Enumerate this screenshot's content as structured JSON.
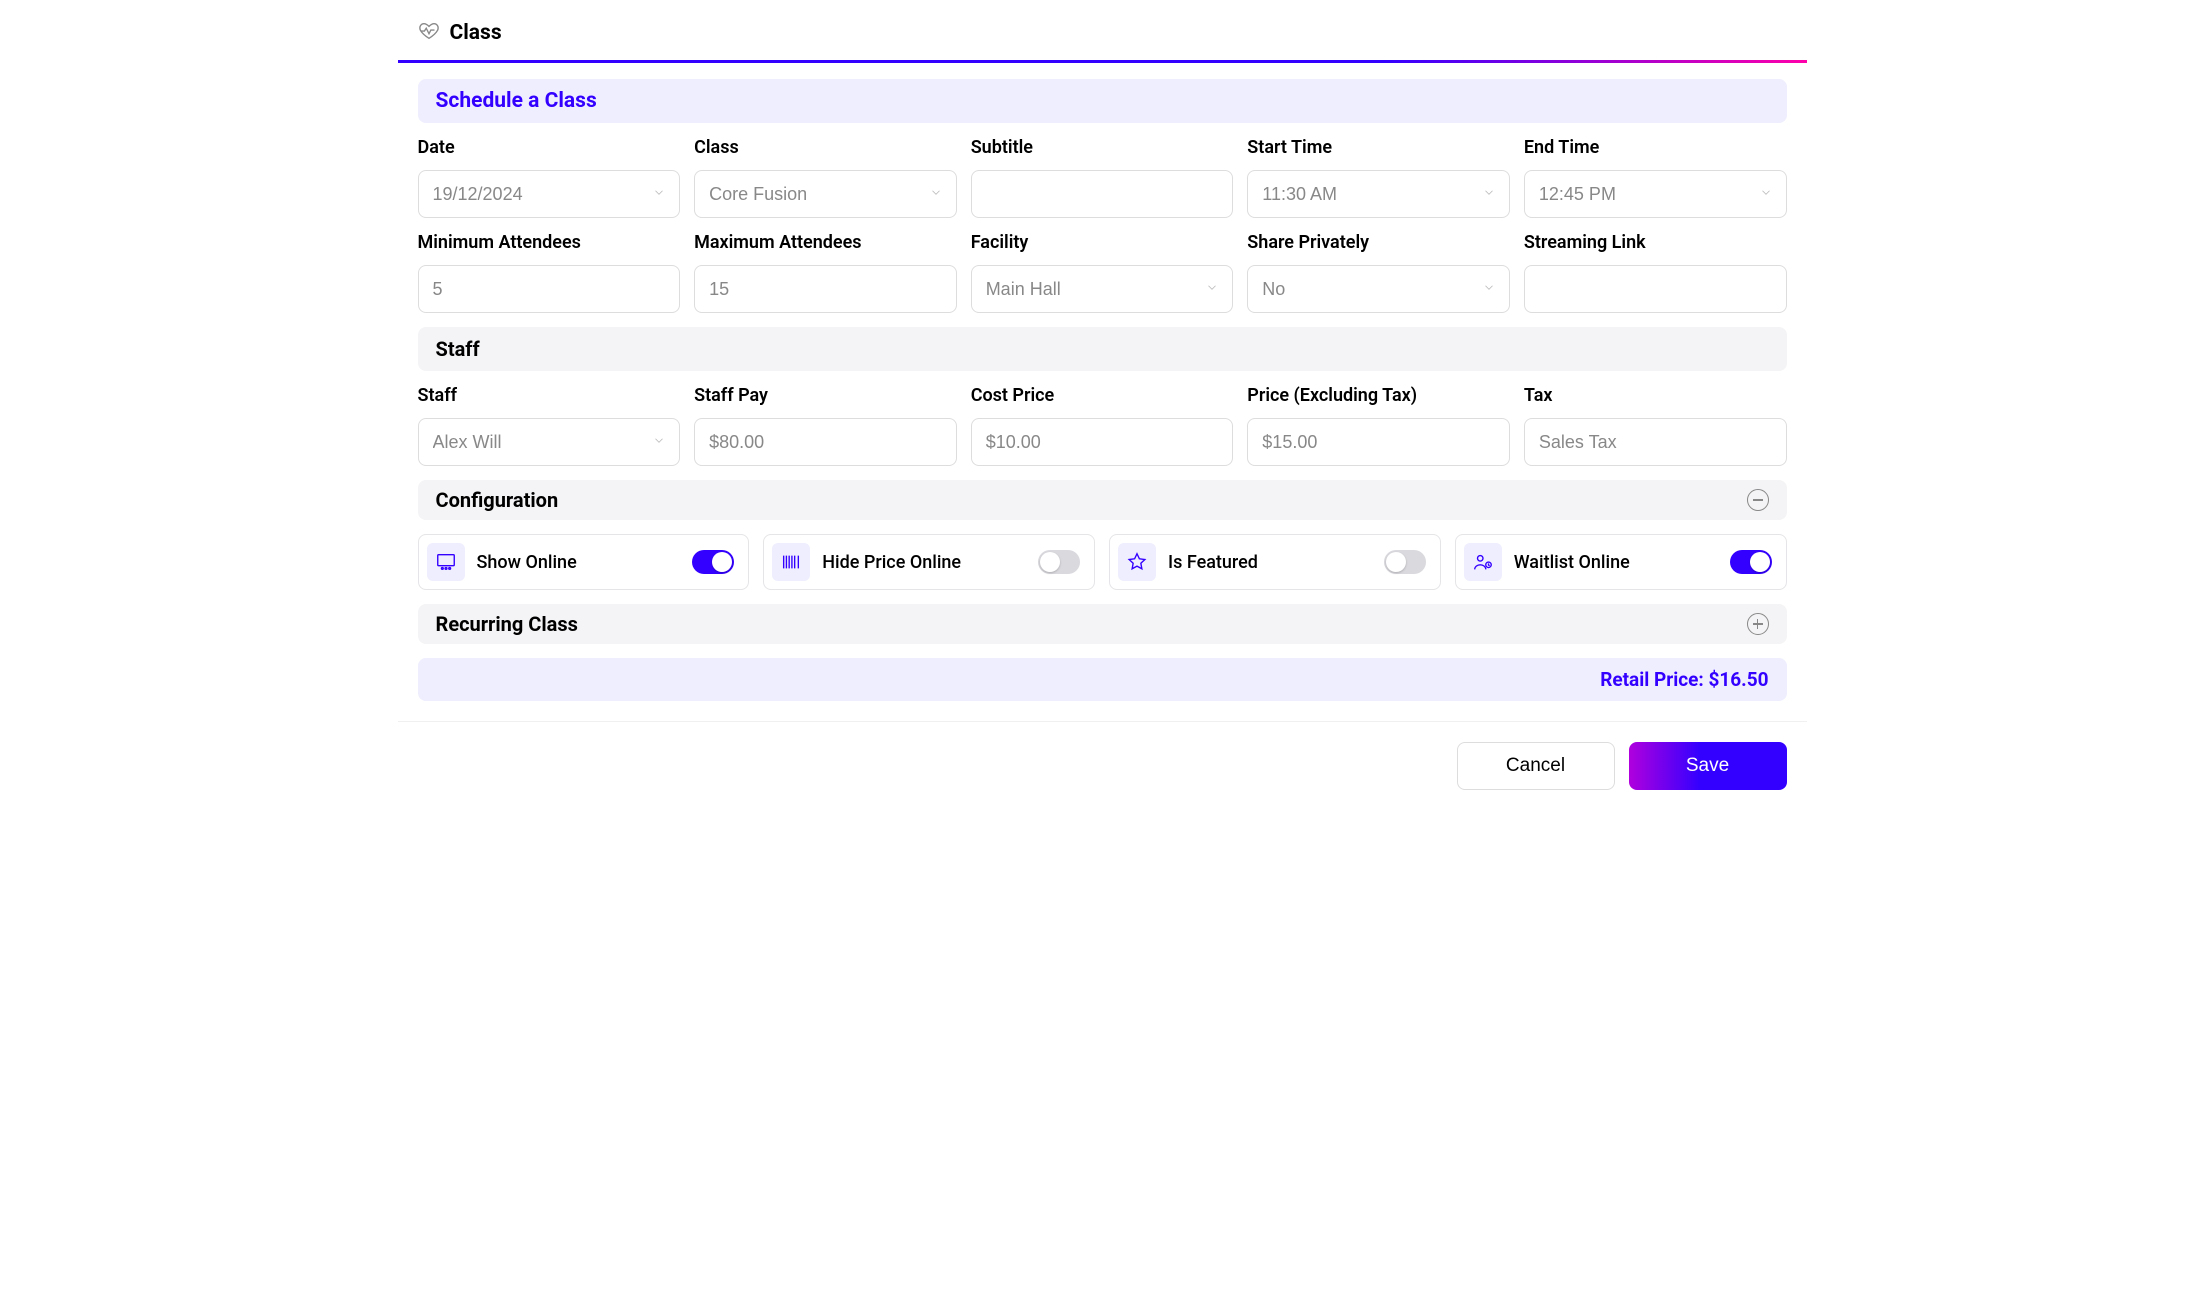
{
  "header": {
    "title": "Class"
  },
  "sections": {
    "schedule_title": "Schedule a Class",
    "staff_title": "Staff",
    "config_title": "Configuration",
    "recurring_title": "Recurring Class"
  },
  "schedule": {
    "date": {
      "label": "Date",
      "value": "19/12/2024"
    },
    "class": {
      "label": "Class",
      "value": "Core Fusion"
    },
    "subtitle": {
      "label": "Subtitle",
      "value": ""
    },
    "start_time": {
      "label": "Start Time",
      "value": "11:30 AM"
    },
    "end_time": {
      "label": "End Time",
      "value": "12:45 PM"
    },
    "min_attendees": {
      "label": "Minimum Attendees",
      "value": "5"
    },
    "max_attendees": {
      "label": "Maximum Attendees",
      "value": "15"
    },
    "facility": {
      "label": "Facility",
      "value": "Main Hall"
    },
    "share_privately": {
      "label": "Share Privately",
      "value": "No"
    },
    "streaming_link": {
      "label": "Streaming Link",
      "value": ""
    }
  },
  "staff": {
    "staff": {
      "label": "Staff",
      "value": "Alex Will"
    },
    "pay": {
      "label": "Staff Pay",
      "value": "$80.00"
    },
    "cost": {
      "label": "Cost Price",
      "value": "$10.00"
    },
    "price": {
      "label": "Price (Excluding Tax)",
      "value": "$15.00"
    },
    "tax": {
      "label": "Tax",
      "value": "Sales Tax"
    }
  },
  "config": {
    "show_online": {
      "label": "Show Online",
      "on": true
    },
    "hide_price": {
      "label": "Hide Price Online",
      "on": false
    },
    "is_featured": {
      "label": "Is Featured",
      "on": false
    },
    "waitlist_online": {
      "label": "Waitlist Online",
      "on": true
    }
  },
  "retail": {
    "label": "Retail Price:",
    "value": "$16.50"
  },
  "footer": {
    "cancel": "Cancel",
    "save": "Save"
  }
}
